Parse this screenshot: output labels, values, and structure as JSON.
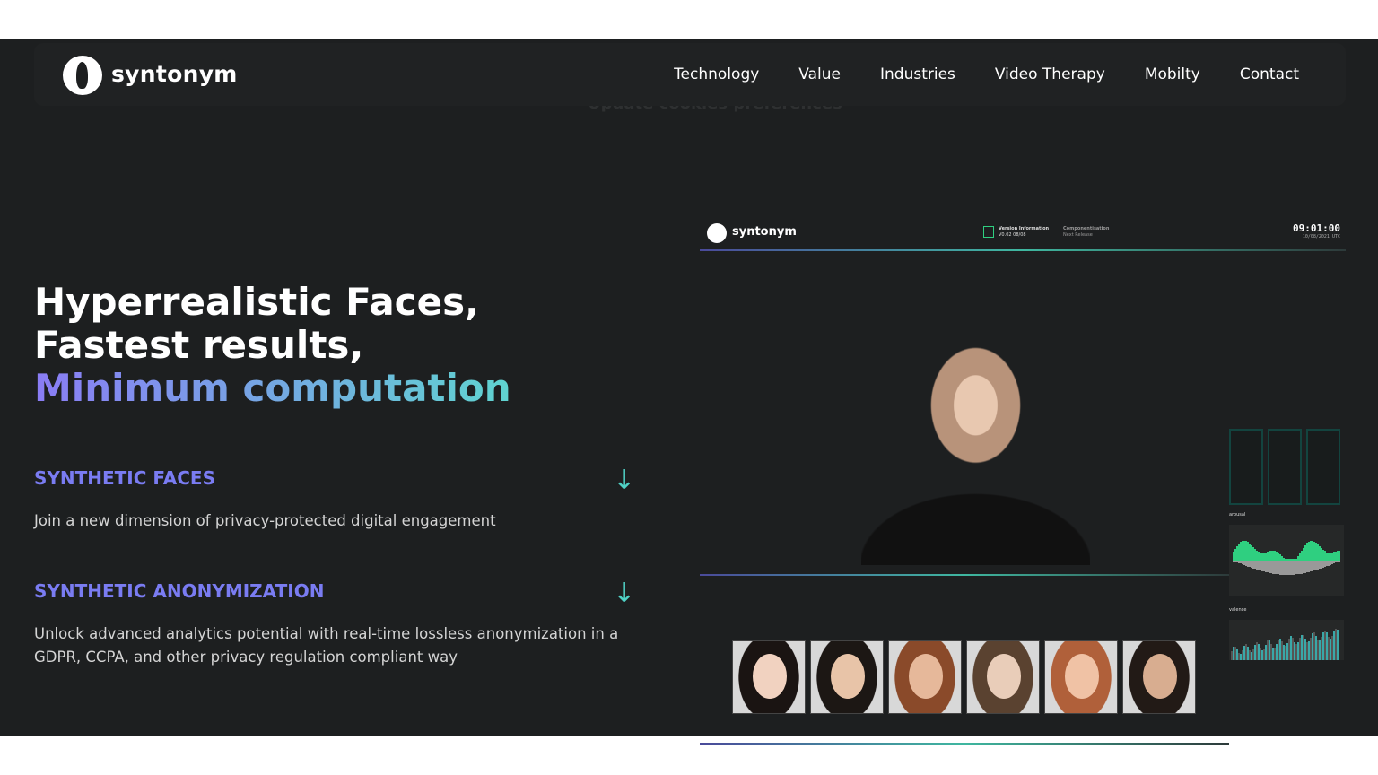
{
  "nav": {
    "brand": "syntonym",
    "items": [
      "Technology",
      "Value",
      "Industries",
      "Video Therapy",
      "Mobilty",
      "Contact"
    ],
    "cookie_text": "Update cookies preferences"
  },
  "hero": {
    "line1": "Hyperrealistic Faces,",
    "line2": "Fastest results,",
    "line3": "Minimum computation"
  },
  "sections": [
    {
      "title": "SYNTHETIC FACES",
      "desc": "Join a new dimension of privacy-protected digital engagement",
      "icon": "arrow-down-icon"
    },
    {
      "title": "SYNTHETIC ANONYMIZATION",
      "desc": "Unlock advanced analytics potential with real-time lossless anonymization in a GDPR, CCPA, and other privacy regulation compliant way",
      "icon": "arrow-down-icon"
    }
  ],
  "demo": {
    "brand": "syntonym",
    "version_title": "Version Information",
    "version_value": "V0.02 08/08",
    "comp_title": "Componentisation",
    "comp_value": "Next Release",
    "time": "09:01:00",
    "date": "10/08/2021 UTC",
    "arousal_label": "arousal",
    "valence_label": "valence"
  },
  "colors": {
    "accent": "#7a7cf2",
    "teal": "#4fd1c5",
    "green": "#2fcf80"
  }
}
